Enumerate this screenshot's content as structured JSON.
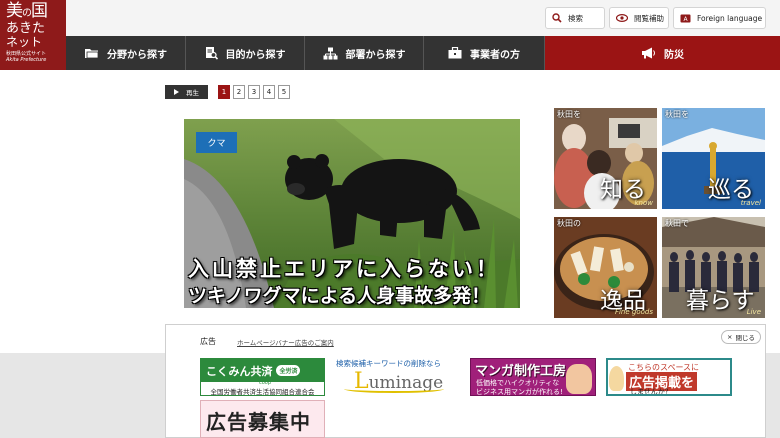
{
  "logo": {
    "line1a": "美",
    "line1b": "の",
    "line1c": "国",
    "line2": "あきた",
    "line3": "ネット",
    "line4": "秋田県公式サイト",
    "line5": "Akita Prefecture"
  },
  "utility": {
    "search": "検索",
    "reading_aid": "閲覧補助",
    "foreign_language": "Foreign language"
  },
  "nav": [
    {
      "label": "分野から探す",
      "icon": "folder-icon"
    },
    {
      "label": "目的から探す",
      "icon": "search-document-icon"
    },
    {
      "label": "部署から探す",
      "icon": "org-chart-icon"
    },
    {
      "label": "事業者の方",
      "icon": "briefcase-icon"
    },
    {
      "label": "防災",
      "icon": "megaphone-icon"
    }
  ],
  "slider": {
    "play_label": "再生",
    "pages": [
      "1",
      "2",
      "3",
      "4",
      "5"
    ],
    "active_page": "1"
  },
  "main_slide": {
    "tag": "クマ",
    "line1": "入山禁止エリアに入らない！",
    "line2": "ツキノワグマによる人身事故多発！"
  },
  "tiles": [
    {
      "label": "秋田を",
      "big": "知る",
      "sub": "know"
    },
    {
      "label": "秋田を",
      "big": "巡る",
      "sub": "travel"
    },
    {
      "label": "秋田の",
      "big": "逸品",
      "sub": "Fine goods"
    },
    {
      "label": "秋田で",
      "big": "暮らす",
      "sub": "Live"
    }
  ],
  "ads": {
    "title": "広告",
    "link": "ホームページバナー広告のご案内",
    "close": "閉じる",
    "banner1": {
      "title": "こくみん共済",
      "pill": "全労済",
      "coop": "coop",
      "bottom": "全国労働者共済生活協同組合連合会"
    },
    "banner2": {
      "top": "検索候補キーワードの削除なら",
      "logo_first": "L",
      "logo_rest": "uminage"
    },
    "banner3": {
      "title": "マンガ制作工房",
      "line1": "低価格でハイクオリティな",
      "line2": "ビジネス用マンガが作れる!"
    },
    "banner4": {
      "line1": "こちらのスペースに",
      "line2": "広告掲載を",
      "line3": "しませんか？"
    },
    "banner5": {
      "title": "広告募集中"
    }
  },
  "colors": {
    "brand_red": "#8e1a1a",
    "nav_bg": "#333333",
    "disaster_red": "#9b1414",
    "tag_blue": "#1d6fb7"
  }
}
